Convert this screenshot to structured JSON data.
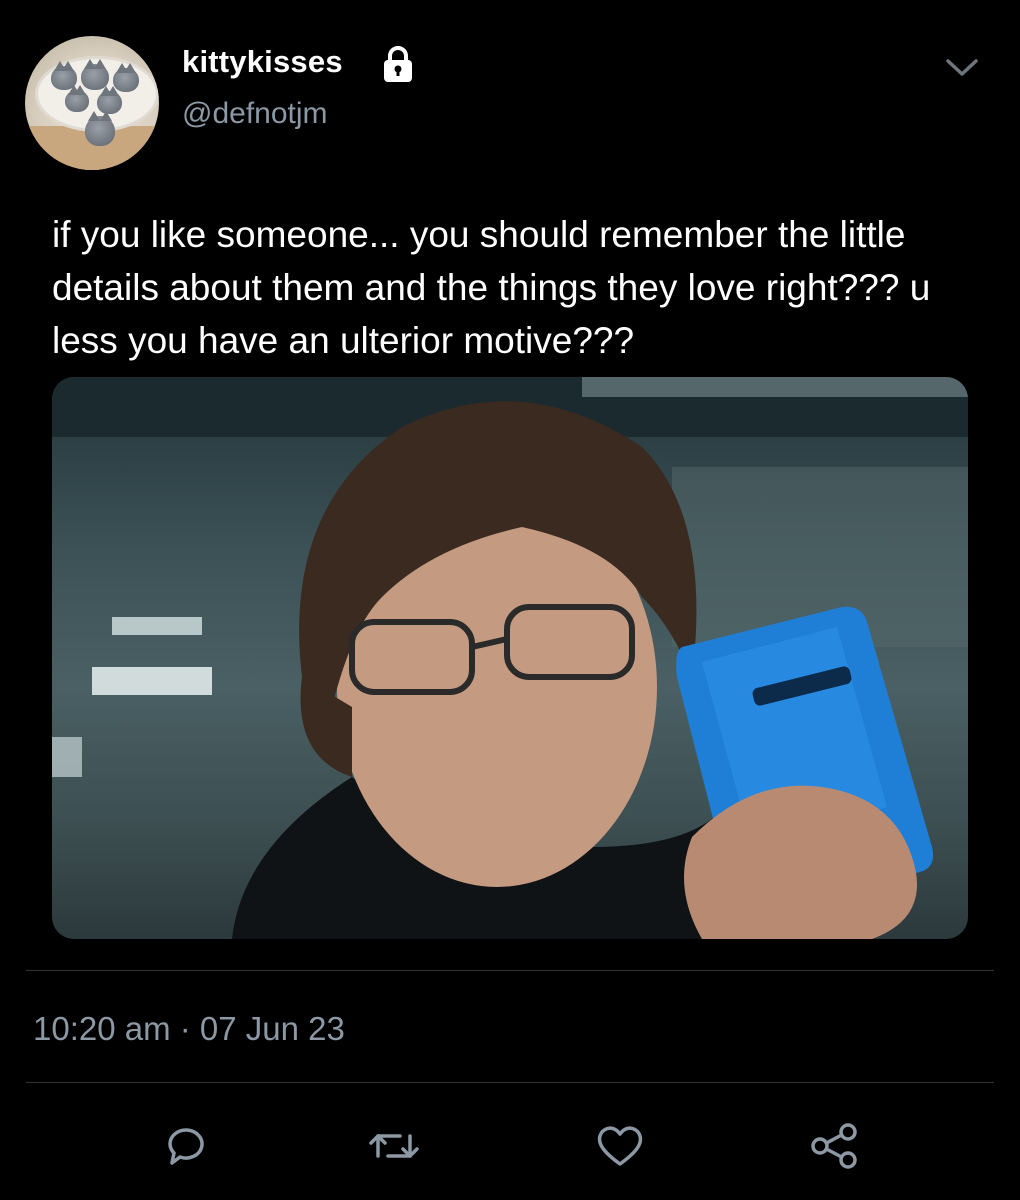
{
  "user": {
    "display_name": "kittykisses",
    "handle": "@defnotjm",
    "protected_icon": "lock-icon",
    "avatar": "avatar-kittens-photo"
  },
  "tweet": {
    "text": "if you like someone... you should remember the little details about them and the things they love right??? u less you have an ulterior motive???",
    "media": "photo-man-with-glasses-looking-at-phone",
    "time": "10:20 am · 07 Jun 23"
  },
  "actions": [
    "reply-icon",
    "retweet-icon",
    "like-icon",
    "share-icon"
  ],
  "colors": {
    "background": "#000000",
    "text": "#ffffff",
    "secondary": "#8c98a4",
    "divider": "#2f3336",
    "phone_blue": "#1f7fd6"
  }
}
